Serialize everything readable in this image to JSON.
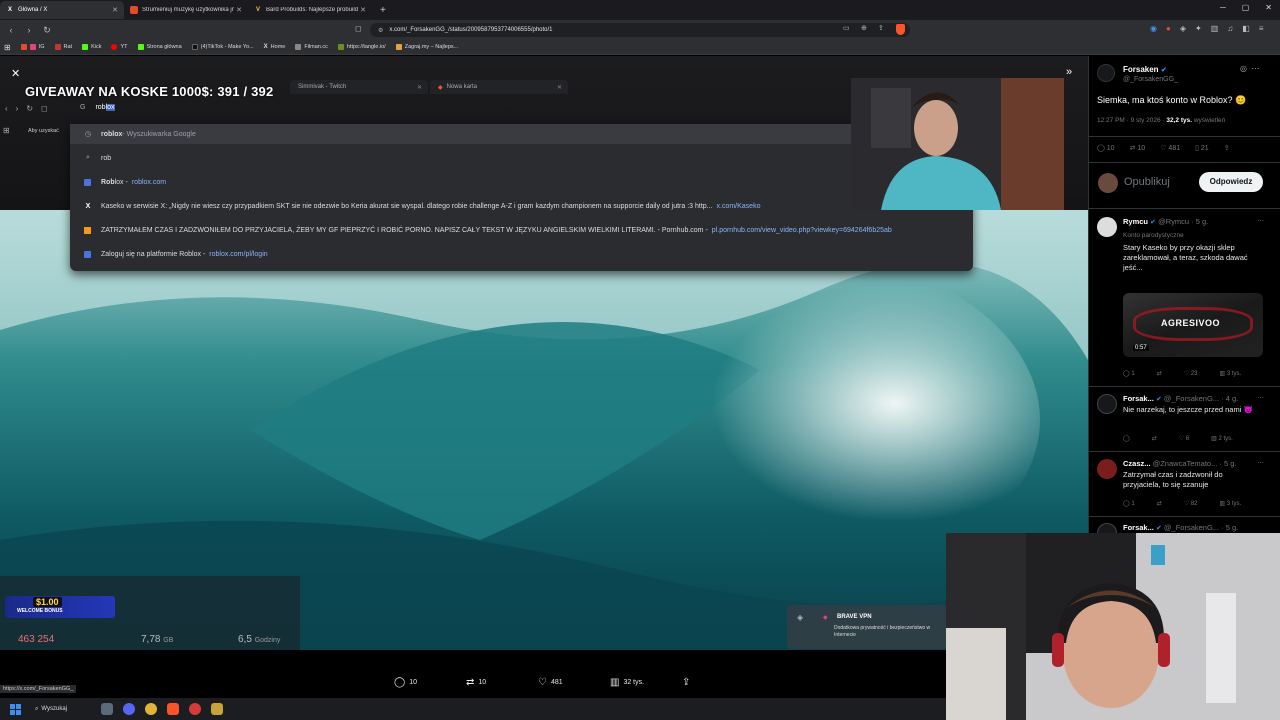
{
  "browser": {
    "tabs": [
      {
        "title": "Główna / X",
        "active": true,
        "icon": "x-icon"
      },
      {
        "title": "Strumieniuj muzykę użytkownika jm",
        "active": false,
        "icon": "media-icon"
      },
      {
        "title": "Bard Probuilds: Najlepsze probuilds",
        "active": false,
        "icon": "v-icon"
      }
    ],
    "url": "x.com/_ForsakenGG_/status/2009587953774006555/photo/1",
    "bookmarks": [
      "IG",
      "Rat",
      "Kick",
      "YT",
      "Strona główna",
      "(4)TikTok - Make Yo...",
      "Home",
      "Filman.cc",
      "https://tangle.io/",
      "Zagraj.my – Najleps..."
    ]
  },
  "stream": {
    "giveaway": "GIVEAWAY NA KOSKE 1000$: 391 / 392",
    "tabs": [
      "Simmivak - Twitch",
      "Nowa karta"
    ],
    "search_typed": "rob",
    "search_selected": "lox",
    "hint": "Aby uzyskać",
    "suggestions": [
      {
        "icon": "clock-icon",
        "bold": "roblox",
        "text": " - Wyszukiwarka Google",
        "url": ""
      },
      {
        "icon": "search-icon",
        "bold": "",
        "text": "rob",
        "url": ""
      },
      {
        "icon": "roblox-icon",
        "bold": "Rob",
        "text": "lox - ",
        "url": "roblox.com"
      },
      {
        "icon": "x-icon",
        "bold": "",
        "text": "Kaseko w serwisie X: „Nigdy nie wiesz czy przypadkiem SKT sie nie odezwie bo Keria akurat sie wyspal. dlatego robie challenge A-Z i gram kazdym championem na supporcie daily od jutra :3 http...",
        "url": "x.com/Kaseko"
      },
      {
        "icon": "pornhub-icon",
        "bold": "",
        "text": "ZATRZYMAŁEM CZAS I ZADZWONIŁEM DO PRZYJACIELA, ŻEBY MY GF PIEPRZYĆ I ROBIĆ PORNO. NAPISZ CAŁY TEKST W JĘZYKU ANGIELSKIM WIELKIMI LITERAMI. - Pornhub.com -",
        "url": "pl.pornhub.com/view_video.php?viewkey=694264f6b25ab"
      },
      {
        "icon": "roblox-icon",
        "bold": "",
        "text": "Zaloguj się na platformie Roblox - ",
        "url": "roblox.com/pl/login"
      }
    ],
    "bonus_amount": "$1.00",
    "bonus_label": "WELCOME BONUS",
    "stats": [
      {
        "value": "463 254",
        "unit": ""
      },
      {
        "value": "7,78",
        "unit": "GB"
      },
      {
        "value": "6,5",
        "unit": "Godziny"
      }
    ],
    "vpn_title": "BRAVE VPN",
    "vpn_desc": "Dodatkowa prywatność i bezpieczeństwo w Internecie"
  },
  "actions": {
    "replies": "10",
    "reposts": "10",
    "likes": "481",
    "views": "32 tys."
  },
  "post": {
    "author": "Forsaken",
    "handle": "@_ForsakenGG_",
    "text": "Siemka, ma ktoś konto w Roblox? 😊",
    "time": "12:27 PM · 9 sty 2026 · ",
    "views_count": "32,2 tys.",
    "views_label": " wyświetleń",
    "replies": "10",
    "reposts": "10",
    "likes": "481",
    "bookmarks": "21",
    "reply_placeholder": "Opublikuj",
    "reply_button": "Odpowiedz"
  },
  "comments": [
    {
      "name": "Rymcu",
      "handle": "@Rymcu · 5 g.",
      "tag": "Konto parodystyczne",
      "text": "Stary Kaseko by przy okazji sklep zareklamował, a teraz, szkoda dawać jeść...",
      "thumb_title": "AGRESIVOO",
      "thumb_duration": "0:57",
      "stats": [
        "1",
        "",
        "23",
        "3 tys."
      ]
    },
    {
      "name": "Forsak...",
      "handle": "@_ForsakenG... · 4 g.",
      "text": "Nie narzekaj, to jeszcze przed nami 😈",
      "stats": [
        "",
        "",
        "6",
        "2 tys."
      ]
    },
    {
      "name": "Czasz...",
      "handle": "@ZnawcaTemato... · 5 g.",
      "text": "Zatrzymał czas i zadzwonił do przyjaciela, to się szanuje",
      "stats": [
        "1",
        "",
        "82",
        "3 tys."
      ]
    },
    {
      "name": "Forsak...",
      "handle": "@_ForsakenG... · 5 g.",
      "text": "",
      "stats": []
    }
  ],
  "status_url": "https://x.com/_ForsakenGG_",
  "taskbar": {
    "search_label": "Wyszukaj"
  }
}
